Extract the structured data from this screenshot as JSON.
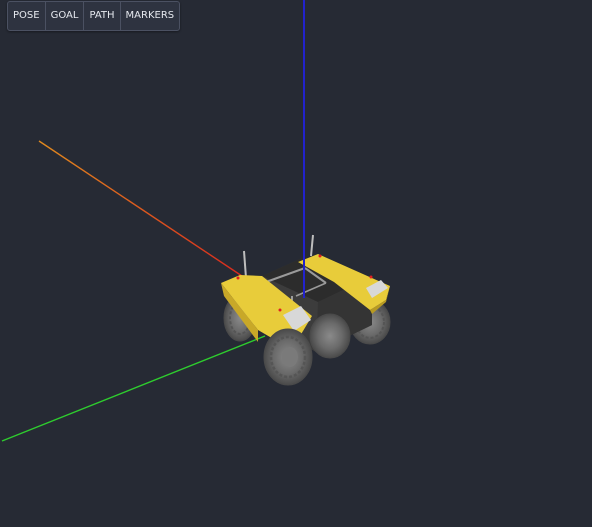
{
  "toolbar": {
    "buttons": [
      {
        "label": "POSE"
      },
      {
        "label": "GOAL"
      },
      {
        "label": "PATH"
      },
      {
        "label": "MARKERS"
      }
    ]
  },
  "scene": {
    "background_color": "#262a34",
    "axes": {
      "x_color": "#e0501e",
      "y_color": "#2ecc2e",
      "z_color": "#2222cc"
    },
    "robot": {
      "body_color": "#e8cc3a",
      "chassis_color": "#3a3a3a",
      "wheel_color": "#6a6a6a",
      "light_color": "#cccccc"
    }
  }
}
